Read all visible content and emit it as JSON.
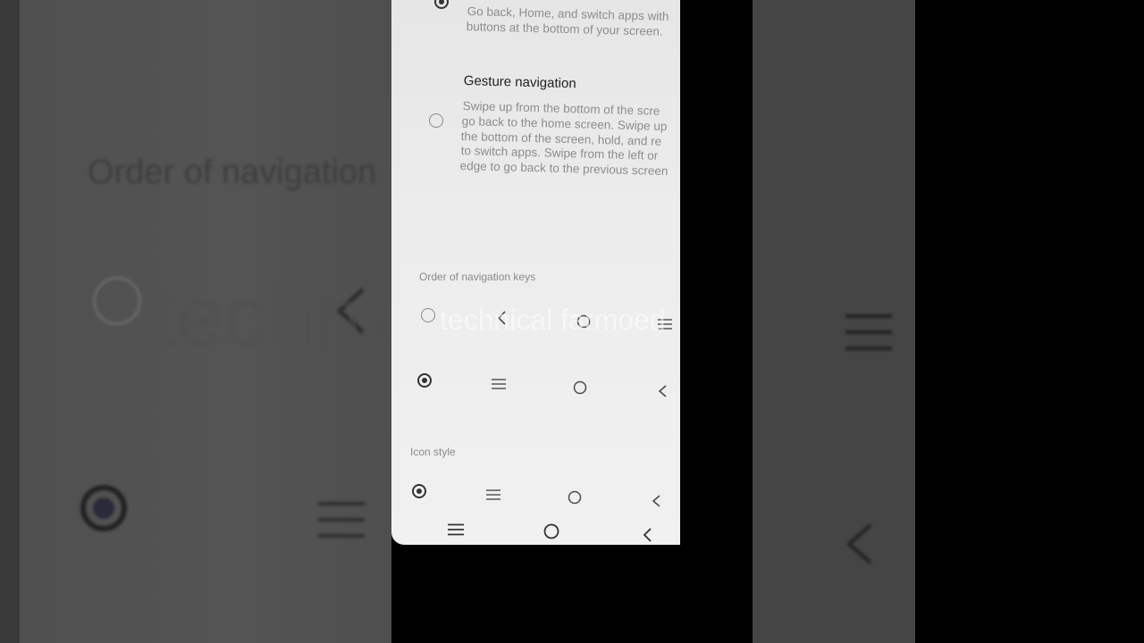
{
  "navigation_modes": {
    "buttons_description": [
      "Go back, Home, and switch apps with",
      "buttons at the bottom of your screen."
    ],
    "gesture_title": "Gesture navigation",
    "gesture_description": [
      "Swipe up from the bottom of the scre",
      "go back to the home screen. Swipe up",
      "the bottom of the screen, hold, and re",
      "to switch apps. Swipe from the left or",
      "edge to go back to the previous screen"
    ]
  },
  "order_section": {
    "label": "Order of navigation keys",
    "options": [
      {
        "selected": false,
        "keys": [
          "back-icon",
          "home-icon",
          "menu-icon"
        ]
      },
      {
        "selected": true,
        "keys": [
          "menu-icon",
          "home-icon",
          "back-icon"
        ]
      }
    ]
  },
  "icon_style_section": {
    "label": "Icon style",
    "options": [
      {
        "selected": true,
        "keys": [
          "menu-icon",
          "home-icon",
          "back-icon"
        ]
      }
    ]
  },
  "system_nav_bar": [
    "menu-icon",
    "home-icon",
    "back-icon"
  ],
  "watermark": "technical farmoed",
  "background": {
    "heading": "Order of navigation",
    "watermark": "technical farmoed"
  }
}
